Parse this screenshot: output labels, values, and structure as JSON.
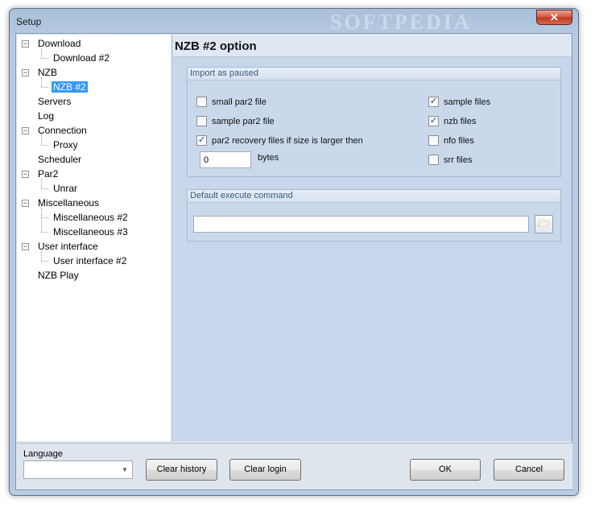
{
  "window": {
    "title": "Setup",
    "watermark": "SOFTPEDIA",
    "close_glyph": "✕"
  },
  "tree": {
    "items": [
      {
        "label": "Download",
        "expander": "−"
      },
      {
        "label": "Download #2"
      },
      {
        "label": "NZB",
        "expander": "−"
      },
      {
        "label": "NZB #2",
        "selected": true
      },
      {
        "label": "Servers"
      },
      {
        "label": "Log"
      },
      {
        "label": "Connection",
        "expander": "−"
      },
      {
        "label": "Proxy"
      },
      {
        "label": "Scheduler"
      },
      {
        "label": "Par2",
        "expander": "−"
      },
      {
        "label": "Unrar"
      },
      {
        "label": "Miscellaneous",
        "expander": "−"
      },
      {
        "label": "Miscellaneous #2"
      },
      {
        "label": "Miscellaneous #3"
      },
      {
        "label": "User interface",
        "expander": "−"
      },
      {
        "label": "User interface #2"
      },
      {
        "label": "NZB Play"
      }
    ]
  },
  "panel": {
    "title": "NZB #2 option",
    "import_group": {
      "label": "Import as paused",
      "left_options": [
        {
          "label": "small par2 file",
          "checked": false
        },
        {
          "label": "sample par2 file",
          "checked": false
        },
        {
          "label": "par2 recovery files if size is larger then",
          "checked": true
        }
      ],
      "right_options": [
        {
          "label": "sample files",
          "checked": true
        },
        {
          "label": "nzb files",
          "checked": true
        },
        {
          "label": "nfo files",
          "checked": false
        },
        {
          "label": "srr files",
          "checked": false
        }
      ],
      "size_value": "0",
      "size_unit": "bytes",
      "check_glyph": "✓"
    },
    "execute_group": {
      "label": "Default execute command",
      "command_value": "",
      "browse_icon": "folder-open-icon",
      "browse_glyph": "🗁"
    }
  },
  "footer": {
    "language_label": "Language",
    "language_value": "",
    "dropdown_glyph": "▼",
    "clear_history": "Clear history",
    "clear_login": "Clear login",
    "ok": "OK",
    "cancel": "Cancel"
  }
}
